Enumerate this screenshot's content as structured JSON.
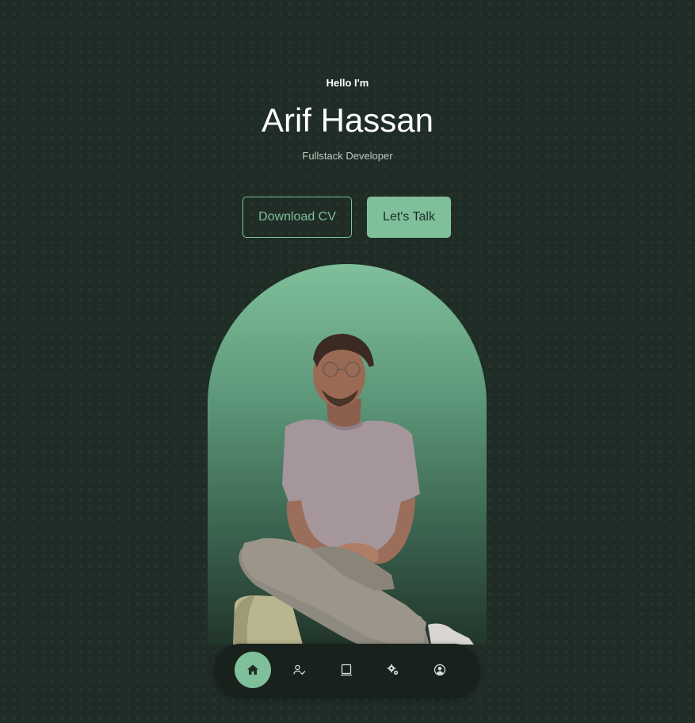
{
  "hero": {
    "greeting": "Hello I'm",
    "name": "Arif Hassan",
    "role": "Fullstack Developer"
  },
  "actions": {
    "download_cv_label": "Download CV",
    "lets_talk_label": "Let's Talk"
  },
  "portrait": {
    "alt": "Portrait of Arif Hassan"
  },
  "nav": {
    "items": [
      {
        "name": "home",
        "icon": "home-icon",
        "active": true
      },
      {
        "name": "about",
        "icon": "user-check-icon",
        "active": false
      },
      {
        "name": "experience",
        "icon": "book-icon",
        "active": false
      },
      {
        "name": "services",
        "icon": "gears-icon",
        "active": false
      },
      {
        "name": "contact",
        "icon": "user-circle-icon",
        "active": false
      }
    ]
  },
  "colors": {
    "background": "#1f2d26",
    "accent": "#7fbf9a",
    "nav_background": "#18211c"
  }
}
